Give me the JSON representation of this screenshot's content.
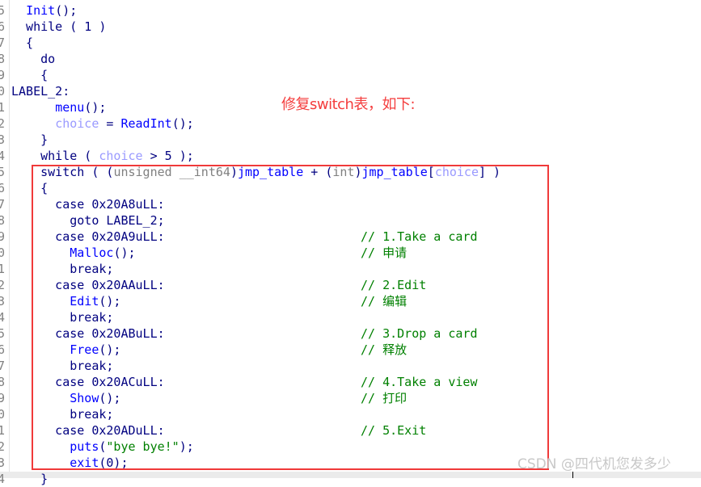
{
  "annotation": "修复switch表，如下:",
  "watermark": "CSDN @四代机您发多少",
  "colors": {
    "keyword": "#000080",
    "function": "#0000ff",
    "variable": "#9a9aff",
    "type": "#808080",
    "comment": "#008000",
    "annotation": "#f43d3d",
    "highlight_box": "#f03a3a"
  },
  "lines": [
    {
      "n": "5",
      "code": [
        [
          "  ",
          ""
        ],
        [
          "Init",
          "fn"
        ],
        [
          "();",
          "kw"
        ]
      ]
    },
    {
      "n": "6",
      "code": [
        [
          "  while ( 1 )",
          "kw"
        ]
      ]
    },
    {
      "n": "7",
      "code": [
        [
          "  {",
          "kw"
        ]
      ]
    },
    {
      "n": "8",
      "code": [
        [
          "    do",
          "kw"
        ]
      ]
    },
    {
      "n": "9",
      "code": [
        [
          "    {",
          "kw"
        ]
      ]
    },
    {
      "n": "0",
      "code": [
        [
          "LABEL_2:",
          "kw"
        ]
      ]
    },
    {
      "n": "1",
      "code": [
        [
          "      ",
          ""
        ],
        [
          "menu",
          "fn"
        ],
        [
          "();",
          "kw"
        ]
      ]
    },
    {
      "n": "2",
      "code": [
        [
          "      ",
          ""
        ],
        [
          "choice",
          "var"
        ],
        [
          " = ",
          "kw"
        ],
        [
          "ReadInt",
          "fn"
        ],
        [
          "();",
          "kw"
        ]
      ]
    },
    {
      "n": "3",
      "code": [
        [
          "    }",
          "kw"
        ]
      ]
    },
    {
      "n": "4",
      "code": [
        [
          "    while ( ",
          "kw"
        ],
        [
          "choice",
          "var"
        ],
        [
          " > 5 );",
          "kw"
        ]
      ]
    },
    {
      "n": "5",
      "code": [
        [
          "    switch ( (",
          "kw"
        ],
        [
          "unsigned __int64",
          "ty"
        ],
        [
          ")",
          "kw"
        ],
        [
          "jmp_table",
          "fn"
        ],
        [
          " + (",
          "kw"
        ],
        [
          "int",
          "ty"
        ],
        [
          ")",
          "kw"
        ],
        [
          "jmp_table",
          "fn"
        ],
        [
          "[",
          "kw"
        ],
        [
          "choice",
          "var"
        ],
        [
          "] )",
          "kw"
        ]
      ]
    },
    {
      "n": "6",
      "code": [
        [
          "    {",
          "kw"
        ]
      ]
    },
    {
      "n": "7",
      "code": [
        [
          "      case 0x20A8uLL:",
          "kw"
        ]
      ]
    },
    {
      "n": "8",
      "code": [
        [
          "        goto LABEL_2;",
          "kw"
        ]
      ]
    },
    {
      "n": "9",
      "code": [
        [
          "      case 0x20A9uLL:",
          "kw"
        ]
      ],
      "comment": "// 1.Take a card"
    },
    {
      "n": "0",
      "code": [
        [
          "        ",
          ""
        ],
        [
          "Malloc",
          "fn"
        ],
        [
          "();",
          "kw"
        ]
      ],
      "comment": "// 申请"
    },
    {
      "n": "1",
      "code": [
        [
          "        break;",
          "kw"
        ]
      ]
    },
    {
      "n": "2",
      "code": [
        [
          "      case 0x20AAuLL:",
          "kw"
        ]
      ],
      "comment": "// 2.Edit"
    },
    {
      "n": "3",
      "code": [
        [
          "        ",
          ""
        ],
        [
          "Edit",
          "fn"
        ],
        [
          "();",
          "kw"
        ]
      ],
      "comment": "// 编辑"
    },
    {
      "n": "4",
      "code": [
        [
          "        break;",
          "kw"
        ]
      ]
    },
    {
      "n": "5",
      "code": [
        [
          "      case 0x20ABuLL:",
          "kw"
        ]
      ],
      "comment": "// 3.Drop a card"
    },
    {
      "n": "6",
      "code": [
        [
          "        ",
          ""
        ],
        [
          "Free",
          "fn"
        ],
        [
          "();",
          "kw"
        ]
      ],
      "comment": "// 释放"
    },
    {
      "n": "7",
      "code": [
        [
          "        break;",
          "kw"
        ]
      ]
    },
    {
      "n": "8",
      "code": [
        [
          "      case 0x20ACuLL:",
          "kw"
        ]
      ],
      "comment": "// 4.Take a view"
    },
    {
      "n": "9",
      "code": [
        [
          "        ",
          ""
        ],
        [
          "Show",
          "fn"
        ],
        [
          "();",
          "kw"
        ]
      ],
      "comment": "// 打印"
    },
    {
      "n": "0",
      "code": [
        [
          "        break;",
          "kw"
        ]
      ]
    },
    {
      "n": "1",
      "code": [
        [
          "      case 0x20ADuLL:",
          "kw"
        ]
      ],
      "comment": "// 5.Exit"
    },
    {
      "n": "2",
      "code": [
        [
          "        ",
          ""
        ],
        [
          "puts",
          "fn"
        ],
        [
          "(",
          "kw"
        ],
        [
          "\"bye bye!\"",
          "str"
        ],
        [
          ");",
          "kw"
        ]
      ]
    },
    {
      "n": "3",
      "code": [
        [
          "        ",
          ""
        ],
        [
          "exit",
          "fn"
        ],
        [
          "(0);",
          "kw"
        ]
      ]
    },
    {
      "n": "4",
      "code": [
        [
          "    }",
          "kw"
        ]
      ]
    }
  ]
}
